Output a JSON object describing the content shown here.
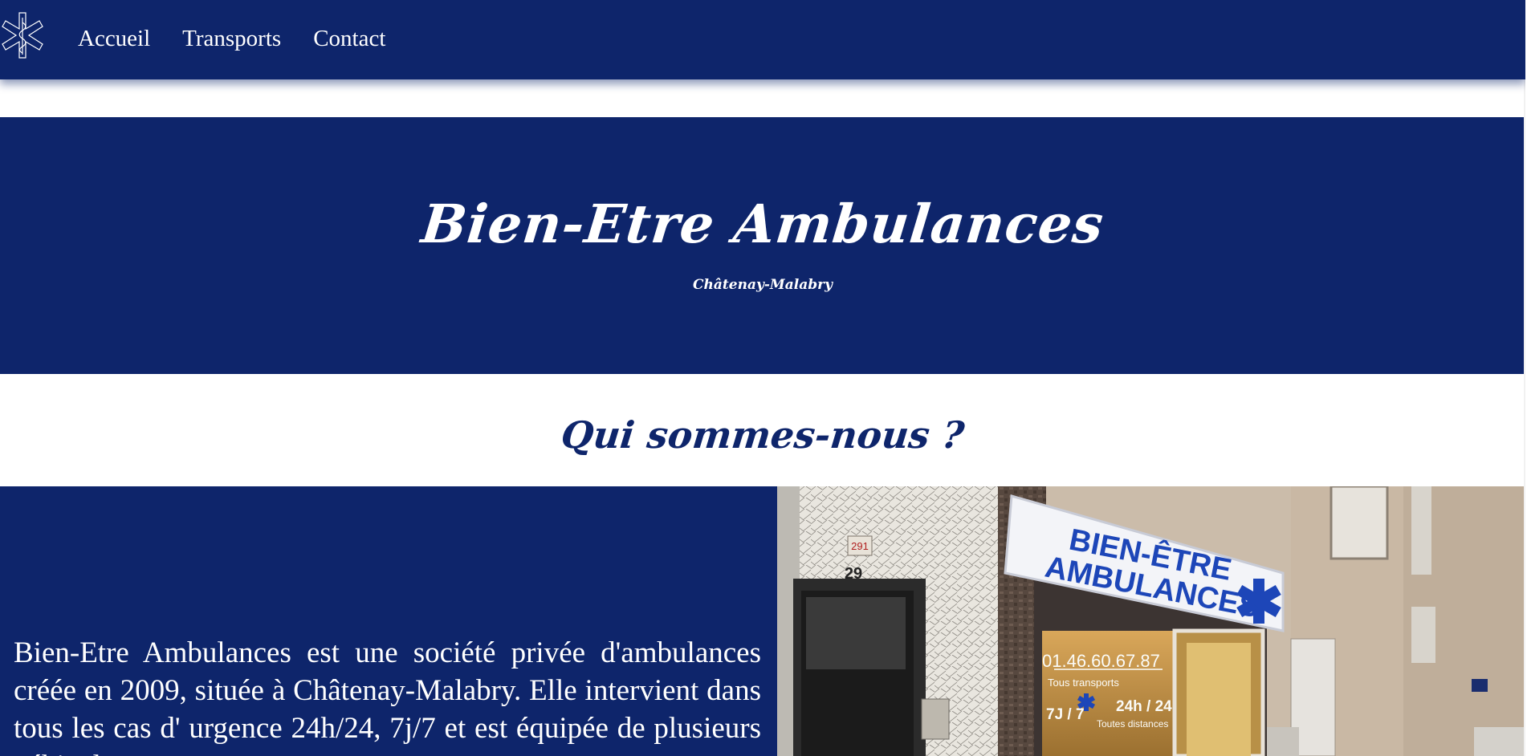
{
  "nav": {
    "logo_icon": "star-of-life-icon",
    "links": [
      "Accueil",
      "Transports",
      "Contact"
    ]
  },
  "hero": {
    "title": "Bien-Etre Ambulances",
    "subtitle": "Châtenay-Malabry"
  },
  "about": {
    "heading": "Qui sommes-nous ?",
    "text": "Bien-Etre Ambulances est une société privée d'ambulances créée en 2009, située à Châtenay-Malabry. Elle intervient dans tous les cas d' urgence 24h/24, 7j/7 et est équipée de plusieurs véhicules",
    "photo": {
      "sign_line1": "BIEN-ÊTRE",
      "sign_line2": "AMBULANCES",
      "phone": "01.46.60.67.87",
      "window_line1": "Tous transports",
      "window_7j": "7J / 7",
      "window_24h": "24h / 24",
      "window_line3": "Toutes distances",
      "plaque_top": "291",
      "plaque_number": "29"
    }
  },
  "colors": {
    "navy": "#0e256b",
    "white": "#ffffff",
    "sign_blue": "#1d46b8"
  }
}
